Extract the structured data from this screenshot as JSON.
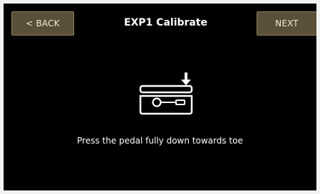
{
  "header": {
    "title": "EXP1 Calibrate",
    "back_label": "< BACK",
    "next_label": "NEXT"
  },
  "main": {
    "instruction": "Press the pedal fully down towards toe",
    "illustration_icon": "expression-pedal-toe-down-icon"
  },
  "colors": {
    "background": "#000000",
    "button_fill": "#5a4f38",
    "button_border": "#8f8363",
    "text": "#ffffff"
  }
}
